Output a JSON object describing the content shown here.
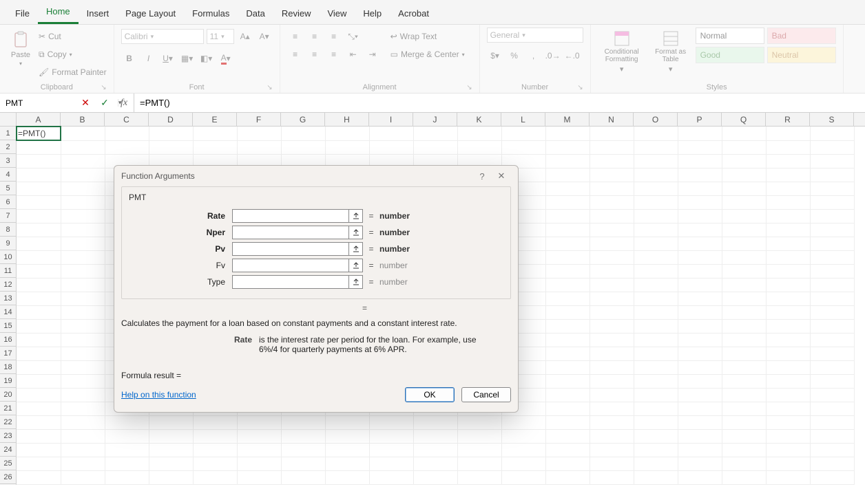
{
  "tabs": [
    "File",
    "Home",
    "Insert",
    "Page Layout",
    "Formulas",
    "Data",
    "Review",
    "View",
    "Help",
    "Acrobat"
  ],
  "active_tab": "Home",
  "clipboard": {
    "paste": "Paste",
    "cut": "Cut",
    "copy": "Copy",
    "format_painter": "Format Painter",
    "label": "Clipboard"
  },
  "font": {
    "name": "Calibri",
    "size": "11",
    "label": "Font"
  },
  "alignment": {
    "wrap": "Wrap Text",
    "merge": "Merge & Center",
    "label": "Alignment"
  },
  "number": {
    "format": "General",
    "label": "Number"
  },
  "styles": {
    "cond": "Conditional Formatting",
    "table": "Format as Table",
    "normal": "Normal",
    "bad": "Bad",
    "good": "Good",
    "neutral": "Neutral",
    "label": "Styles"
  },
  "name_box": "PMT",
  "formula": "=PMT()",
  "columns": [
    "A",
    "B",
    "C",
    "D",
    "E",
    "F",
    "G",
    "H",
    "I",
    "J",
    "K",
    "L",
    "M",
    "N",
    "O",
    "P",
    "Q",
    "R",
    "S"
  ],
  "rows": 26,
  "cell_A1": "=PMT()",
  "dialog": {
    "title": "Function Arguments",
    "fn": "PMT",
    "args": [
      {
        "label": "Rate",
        "bold": true,
        "hint": "number",
        "hint_bold": true
      },
      {
        "label": "Nper",
        "bold": true,
        "hint": "number",
        "hint_bold": true
      },
      {
        "label": "Pv",
        "bold": true,
        "hint": "number",
        "hint_bold": true
      },
      {
        "label": "Fv",
        "bold": false,
        "hint": "number",
        "hint_bold": false
      },
      {
        "label": "Type",
        "bold": false,
        "hint": "number",
        "hint_bold": false
      }
    ],
    "eq_below": "=",
    "description": "Calculates the payment for a loan based on constant payments and a constant interest rate.",
    "arg_desc_label": "Rate",
    "arg_desc_text": "is the interest rate per period for the loan. For example, use 6%/4 for quarterly payments at 6% APR.",
    "formula_result_label": "Formula result =",
    "help": "Help on this function",
    "ok": "OK",
    "cancel": "Cancel"
  }
}
